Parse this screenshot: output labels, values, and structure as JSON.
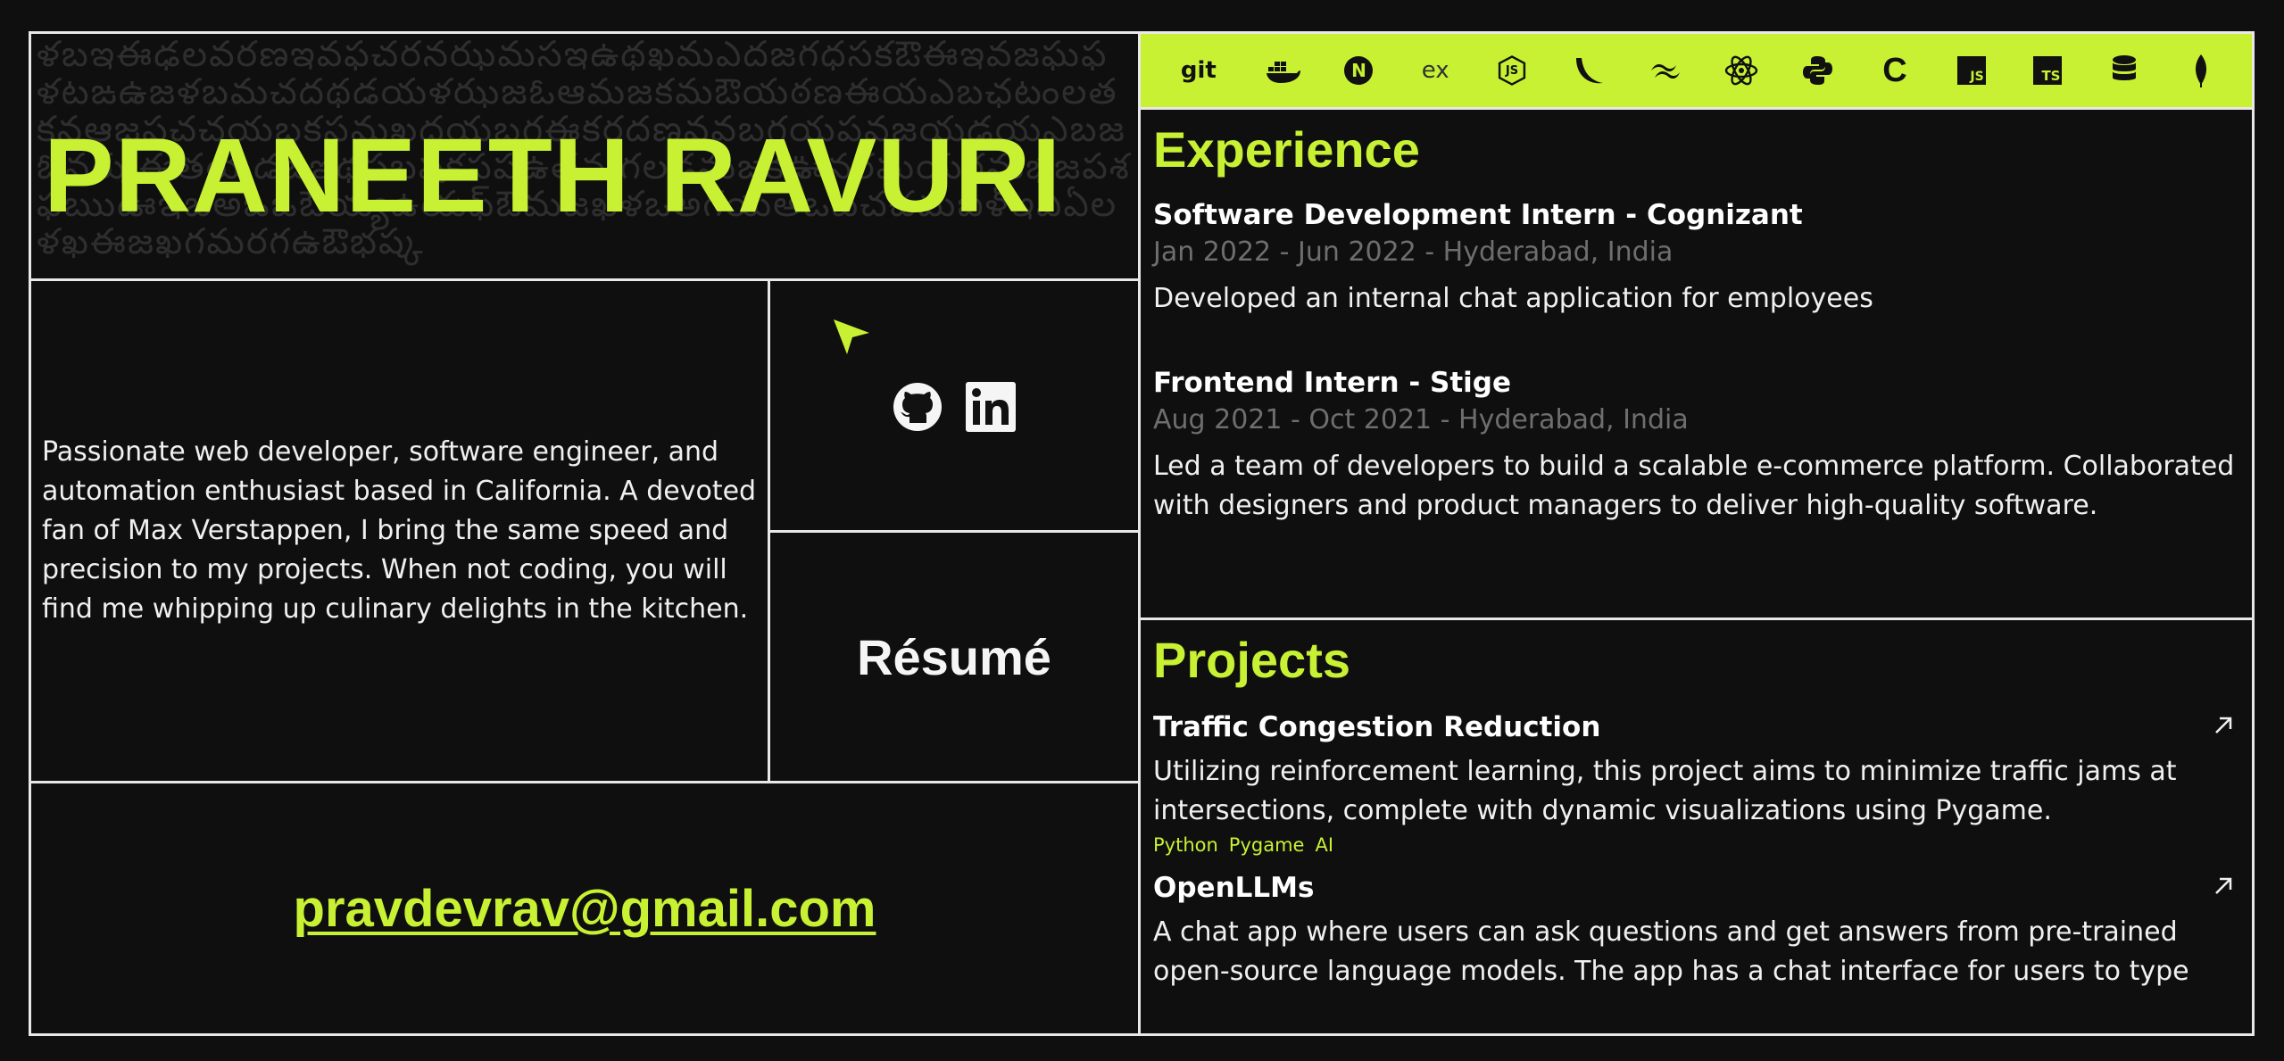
{
  "header": {
    "name": "PRANEETH RAVURI"
  },
  "background_script": "ళబఇఈఢలవరణఇవఫచరనఝమసఇఉథఖమఎదజగధసకఔఈఇవజఘఫళటఙఉజళబమచదథడయళఝజఓఆమజకమఔయఠణఈయఎబఛటంలతకనఆజపచచయబకసమఖదయబగఈకరదణవవబగయపవజయడయఎబజఓనఝఈతయడజఇథసబషకపపఉతమగలఢమజకఊనరఘయగమభజపశఫఋఊఇబఅఒఒఔయ్యఉయఫ్ఔమజఖళఒఅగయఅఒబచచమఐళ్ఇఎఏలళఖఈజఖగమరగఉఔభష్క",
  "bio": {
    "text": "Passionate web developer, software engineer, and automation enthusiast based in California. A devoted fan of Max Verstappen, I bring the same speed and precision to my projects. When not coding, you will find me whipping up culinary delights in the kitchen."
  },
  "socials": {
    "github_icon": "github-icon",
    "linkedin_icon": "linkedin-icon",
    "cursor_icon": "cursor-arrow-icon"
  },
  "resume": {
    "label": "Résumé"
  },
  "contact": {
    "email": "pravdevrav@gmail.com"
  },
  "tech_icons": [
    {
      "name": "git-icon",
      "text": "git"
    },
    {
      "name": "docker-icon",
      "text": ""
    },
    {
      "name": "nextjs-icon",
      "text": "N"
    },
    {
      "name": "express-icon",
      "text": "ex"
    },
    {
      "name": "nodejs-icon",
      "text": "JS"
    },
    {
      "name": "bash-icon",
      "text": ""
    },
    {
      "name": "tailwind-icon",
      "text": ""
    },
    {
      "name": "react-icon",
      "text": ""
    },
    {
      "name": "python-icon",
      "text": ""
    },
    {
      "name": "c-icon",
      "text": "C"
    },
    {
      "name": "javascript-icon",
      "text": "JS"
    },
    {
      "name": "typescript-icon",
      "text": "TS"
    },
    {
      "name": "database-icon",
      "text": ""
    },
    {
      "name": "mongodb-icon",
      "text": ""
    }
  ],
  "experience": {
    "title": "Experience",
    "jobs": [
      {
        "title": "Software Development Intern - Cognizant",
        "meta": "Jan 2022 - Jun 2022 - Hyderabad, India",
        "desc": "Developed an internal chat application for employees"
      },
      {
        "title": "Frontend Intern - Stige",
        "meta": "Aug 2021 - Oct 2021 - Hyderabad, India",
        "desc": "Led a team of developers to build a scalable e-commerce platform. Collaborated with designers and product managers to deliver high-quality software."
      }
    ]
  },
  "projects": {
    "title": "Projects",
    "items": [
      {
        "title": "Traffic Congestion Reduction",
        "desc": "Utilizing reinforcement learning, this project aims to minimize traffic jams at intersections, complete with dynamic visualizations using Pygame.",
        "tags": [
          "Python",
          "Pygame",
          "AI"
        ]
      },
      {
        "title": "OpenLLMs",
        "desc": "A chat app where users can ask questions and get answers from pre-trained open-source language models. The app has a chat interface for users to type"
      }
    ]
  },
  "colors": {
    "accent": "#c7f132",
    "background": "#0f0f0f",
    "border": "#e8e8e8",
    "muted": "#6e6e6e"
  }
}
